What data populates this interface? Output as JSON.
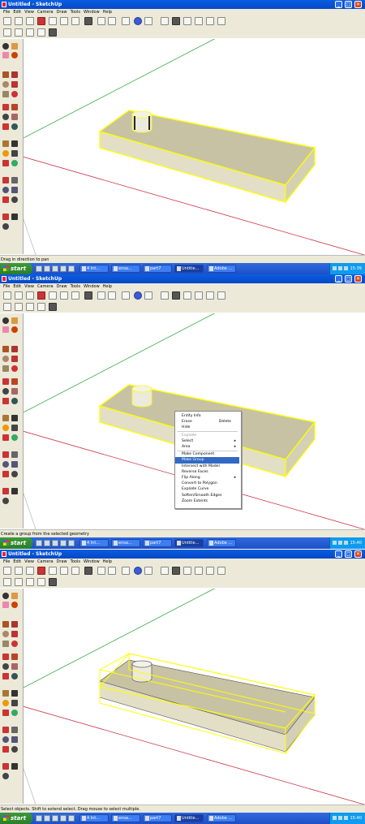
{
  "window": {
    "title": "Untitled - SketchUp"
  },
  "menu": [
    "File",
    "Edit",
    "View",
    "Camera",
    "Draw",
    "Tools",
    "Window",
    "Help"
  ],
  "frames": [
    {
      "status": "Drag in direction to pan",
      "time": "15:39",
      "tasks": [
        "4 Int...",
        "ensa...",
        "part7",
        "Untitle...",
        "Adobe ..."
      ]
    },
    {
      "status": "Create a group from the selected geometry",
      "time": "15:40",
      "tasks": [
        "4 Int...",
        "ensa...",
        "part7",
        "Untitle...",
        "Adobe ..."
      ]
    },
    {
      "status": "Select objects. Shift to extend select. Drag mouse to select multiple.",
      "time": "15:40",
      "tasks": [
        "4 Int...",
        "ensa...",
        "part7",
        "Untitle...",
        "Adobe ..."
      ]
    }
  ],
  "taskbar": {
    "start": "start"
  },
  "context_menu": {
    "items": [
      {
        "label": "Entity Info"
      },
      {
        "label": "Erase",
        "shortcut": "Delete"
      },
      {
        "label": "Hide"
      },
      {
        "label": "Explode",
        "disabled": true
      },
      {
        "label": "Select",
        "submenu": true
      },
      {
        "label": "Area",
        "submenu": true
      },
      {
        "label": "Make Component"
      },
      {
        "label": "Make Group",
        "selected": true
      },
      {
        "label": "Intersect with Model"
      },
      {
        "label": "Reverse Faces"
      },
      {
        "label": "Flip Along",
        "submenu": true
      },
      {
        "label": "Convert to Polygon"
      },
      {
        "label": "Explode Curve"
      },
      {
        "label": "Soften/Smooth Edges"
      },
      {
        "label": "Zoom Extents"
      }
    ]
  },
  "colors": {
    "titlebar": "#0548c8",
    "chrome": "#ece9d8",
    "selection": "#ffff00",
    "box_top": "#c8c2a4",
    "box_side": "#e2dfc6",
    "axis_red": "#cc3344",
    "axis_green": "#33aa44"
  },
  "icons": {
    "arrow_submenu": "▸",
    "minimize": "_",
    "maximize": "□",
    "close": "✕"
  }
}
